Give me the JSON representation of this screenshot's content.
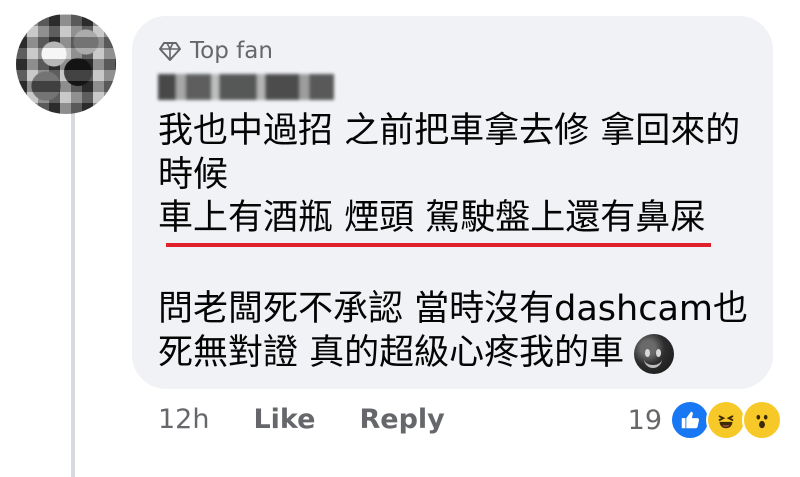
{
  "comment": {
    "badge_label": "Top fan",
    "author_name": "",
    "lines": [
      "我也中過招 之前把車拿去修 拿回來的",
      "時候",
      "車上有酒瓶 煙頭 駕駛盤上還有鼻屎",
      "問老闆死不承認 當時沒有dashcam也",
      "死無對證 真的超級心疼我的車"
    ],
    "emoji_icon": "new-moon-face-icon",
    "underline_color": "#e0202a"
  },
  "actions": {
    "time": "12h",
    "like_label": "Like",
    "reply_label": "Reply"
  },
  "reactions": {
    "count": "19",
    "icons": [
      "like-reaction-icon",
      "haha-reaction-icon",
      "wow-reaction-icon"
    ]
  },
  "colors": {
    "bubble_bg": "#f0f2f5",
    "secondary_text": "#65676b",
    "like_blue": "#1877f2"
  }
}
